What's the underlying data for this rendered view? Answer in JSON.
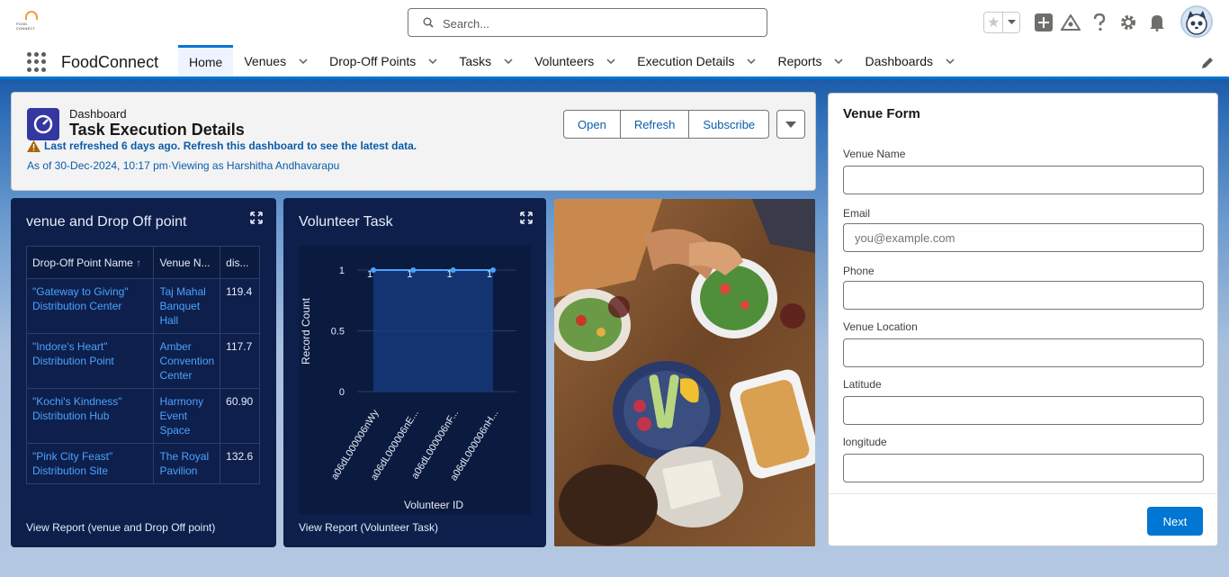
{
  "header": {
    "logo_text": "FOOD CONNECT",
    "search_placeholder": "Search...",
    "icons": [
      "star-icon",
      "chevron-down-icon",
      "add-icon",
      "trailhead-icon",
      "help-icon",
      "gear-icon",
      "bell-icon",
      "avatar"
    ]
  },
  "nav": {
    "app_name": "FoodConnect",
    "tabs": [
      {
        "label": "Home",
        "active": true
      },
      {
        "label": "Venues"
      },
      {
        "label": "Drop-Off Points"
      },
      {
        "label": "Tasks"
      },
      {
        "label": "Volunteers"
      },
      {
        "label": "Execution Details"
      },
      {
        "label": "Reports"
      },
      {
        "label": "Dashboards"
      }
    ]
  },
  "dashboard": {
    "kicker": "Dashboard",
    "title": "Task Execution Details",
    "warning": "Last refreshed 6 days ago. Refresh this dashboard to see the latest data.",
    "as_of": "As of 30-Dec-2024, 10:17 pm·Viewing as Harshitha Andhavarapu",
    "buttons": {
      "open": "Open",
      "refresh": "Refresh",
      "subscribe": "Subscribe"
    }
  },
  "widget_table": {
    "title": "venue and Drop Off point",
    "columns": [
      "Drop-Off Point Name",
      "Venue N...",
      "dis..."
    ],
    "rows": [
      {
        "dropoff": "\"Gateway to Giving\" Distribution Center",
        "venue": "Taj Mahal Banquet Hall",
        "dist": "119.4"
      },
      {
        "dropoff": "\"Indore's Heart\" Distribution Point",
        "venue": "Amber Convention Center",
        "dist": "117.7"
      },
      {
        "dropoff": "\"Kochi's Kindness\" Distribution Hub",
        "venue": "Harmony Event Space",
        "dist": "60.90"
      },
      {
        "dropoff": "\"Pink City Feast\" Distribution Site",
        "venue": "The Royal Pavilion",
        "dist": "132.6"
      }
    ],
    "footer": "View Report (venue and Drop Off point)"
  },
  "widget_chart": {
    "title": "Volunteer Task",
    "footer": "View Report (Volunteer Task)"
  },
  "chart_data": {
    "type": "area",
    "categories": [
      "a06dL000006nWy",
      "a06dL000006nE...",
      "a06dL000006nF...",
      "a06dL000006nH..."
    ],
    "values": [
      1,
      1,
      1,
      1
    ],
    "xlabel": "Volunteer ID",
    "ylabel": "Record Count",
    "yticks": [
      "0",
      "0.5",
      "1"
    ],
    "ylim": [
      0,
      1
    ],
    "data_labels": [
      "1",
      "1",
      "1",
      "1"
    ],
    "line_color": "#4aa3ff",
    "fill_color": "#163a7a"
  },
  "venue_form": {
    "title": "Venue Form",
    "fields": [
      {
        "label": "Venue Name",
        "value": "",
        "placeholder": ""
      },
      {
        "label": "Email",
        "value": "",
        "placeholder": "you@example.com"
      },
      {
        "label": "Phone",
        "value": "",
        "placeholder": ""
      },
      {
        "label": "Venue Location",
        "value": "",
        "placeholder": ""
      },
      {
        "label": "Latitude",
        "value": "",
        "placeholder": ""
      },
      {
        "label": "longitude",
        "value": "",
        "placeholder": ""
      }
    ],
    "next_label": "Next"
  },
  "colors": {
    "brand": "#0176d3",
    "dashboard_bg": "#0e1f4c",
    "link": "#0b5cab"
  }
}
